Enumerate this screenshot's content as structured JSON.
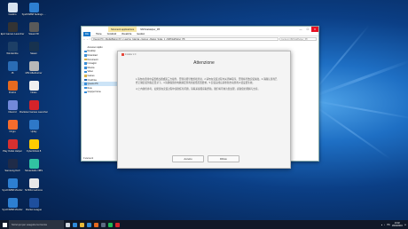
{
  "desktop": {
    "icons": [
      {
        "label": "Cestino",
        "color": "#d8e3ef"
      },
      {
        "label": "SysOrb868\nSettings ...",
        "color": "#2d7fd1"
      },
      {
        "label": "Epic Games\nLauncher",
        "color": "#333333"
      },
      {
        "label": "SteamVR",
        "color": "#5a5a5a"
      },
      {
        "label": "Windscribe",
        "color": "#1d3f66"
      },
      {
        "label": "Steam",
        "color": "#17324f"
      },
      {
        "label": "J6",
        "color": "#2a6cb5"
      },
      {
        "label": "MSI Afterburner",
        "color": "#b8b8b8"
      },
      {
        "label": "Firefox",
        "color": "#e66a1f"
      },
      {
        "label": "Notes",
        "color": "#f0f0f0"
      },
      {
        "label": "Discord",
        "color": "#7289da"
      },
      {
        "label": "Rockstar Games\nLauncher",
        "color": "#d5232a"
      },
      {
        "label": "Origin",
        "color": "#f56c2d"
      },
      {
        "label": "Uplay",
        "color": "#2e78c8"
      },
      {
        "label": "Play Outlet\nHelper",
        "color": "#d63030"
      },
      {
        "label": "CyberGhost 8",
        "color": "#ffcc00"
      },
      {
        "label": "Samsung\nDeX",
        "color": "#1f2b48"
      },
      {
        "label": "Streamlabs\nOBS",
        "color": "#31c3a2"
      },
      {
        "label": "SysOrb868\nMonitor",
        "color": "#2d7fd1"
      },
      {
        "label": "NVIDIA\nGeForce",
        "color": "#e8e8e8"
      },
      {
        "label": "SysOrb868\nMonitor",
        "color": "#2d7fd1"
      },
      {
        "label": "Rocket\nLeague",
        "color": "#1e4f9e"
      }
    ]
  },
  "explorer": {
    "context_tab": "Strumenti applicazione",
    "title": "NMTotalHelper_P8",
    "window_controls": {
      "minimize": "—",
      "maximize": "☐",
      "close": "✕"
    },
    "ribbon": [
      "File",
      "Home",
      "Condividi",
      "Visualizza",
      "Gestisci"
    ],
    "address_path": "Questo PC › Media/Bagno (D:) › Laurina_Giangia › Games › Radeo_Scale_1 › NMTotalHelper_P8",
    "search_placeholder": "Cerca in NMTotalHelper_P8",
    "nav": [
      {
        "label": "Accesso rapido",
        "hl": false,
        "color": "#ffffff"
      },
      {
        "label": "Desktop",
        "hl": false,
        "color": "#3a8fd8"
      },
      {
        "label": "Download",
        "hl": false,
        "color": "#3a8fd8"
      },
      {
        "label": "Documenti",
        "hl": false,
        "color": "#d9b44a"
      },
      {
        "label": "Immagini",
        "hl": false,
        "color": "#3a8fd8"
      },
      {
        "label": "Musica",
        "hl": false,
        "color": "#3a8fd8"
      },
      {
        "label": "Video",
        "hl": false,
        "color": "#3a8fd8"
      },
      {
        "label": "Games",
        "hl": false,
        "color": "#d9b44a"
      },
      {
        "label": "OneDrive",
        "hl": false,
        "color": "#2a6cb5"
      },
      {
        "label": "Questo PC",
        "hl": true,
        "color": "#3a8fd8"
      },
      {
        "label": "Rete",
        "hl": false,
        "color": "#3a8fd8"
      },
      {
        "label": "Gruppo home",
        "hl": false,
        "color": "#3a8fd8"
      }
    ],
    "status": "9 elementi"
  },
  "modal": {
    "app_name": "Installer 2.0",
    "title": "Attenzione",
    "paragraphs": [
      "1.请勿在游戏中设置修改器或第三方插件，否则可能导致游戏异常。2.请勿在安装过程中关闭本程序，否则将导致安装失败。3.请确认游戏已经正确安装到指定目录下。4.请确保您的电脑满足游戏的最低配置要求。5.安装完成后请重新启动游戏以使设置生效。",
      "以上内容供参考，如果您在安装过程中遇到任何问题，请联系客服获取帮助。我们将尽快为您处理，感谢您的理解与支持。"
    ],
    "accept_label": "Accetto",
    "refuse_label": "Rifiuto"
  },
  "taskbar": {
    "search_placeholder": "Scrivi qui per eseguire la ricerca",
    "apps": [
      {
        "name": "task-view-icon",
        "color": "#cfd6df"
      },
      {
        "name": "edge-icon",
        "color": "#2f8ad8"
      },
      {
        "name": "folder-icon",
        "color": "#e8b939"
      },
      {
        "name": "store-icon",
        "color": "#2f8ad8"
      },
      {
        "name": "firefox-icon",
        "color": "#e66a1f"
      },
      {
        "name": "steam-icon",
        "color": "#5a6b82"
      },
      {
        "name": "spotify-icon",
        "color": "#1db954"
      },
      {
        "name": "app-icon",
        "color": "#d5232a"
      }
    ],
    "time": "13:02",
    "date": "18/03/2019",
    "lang": "ITA"
  }
}
